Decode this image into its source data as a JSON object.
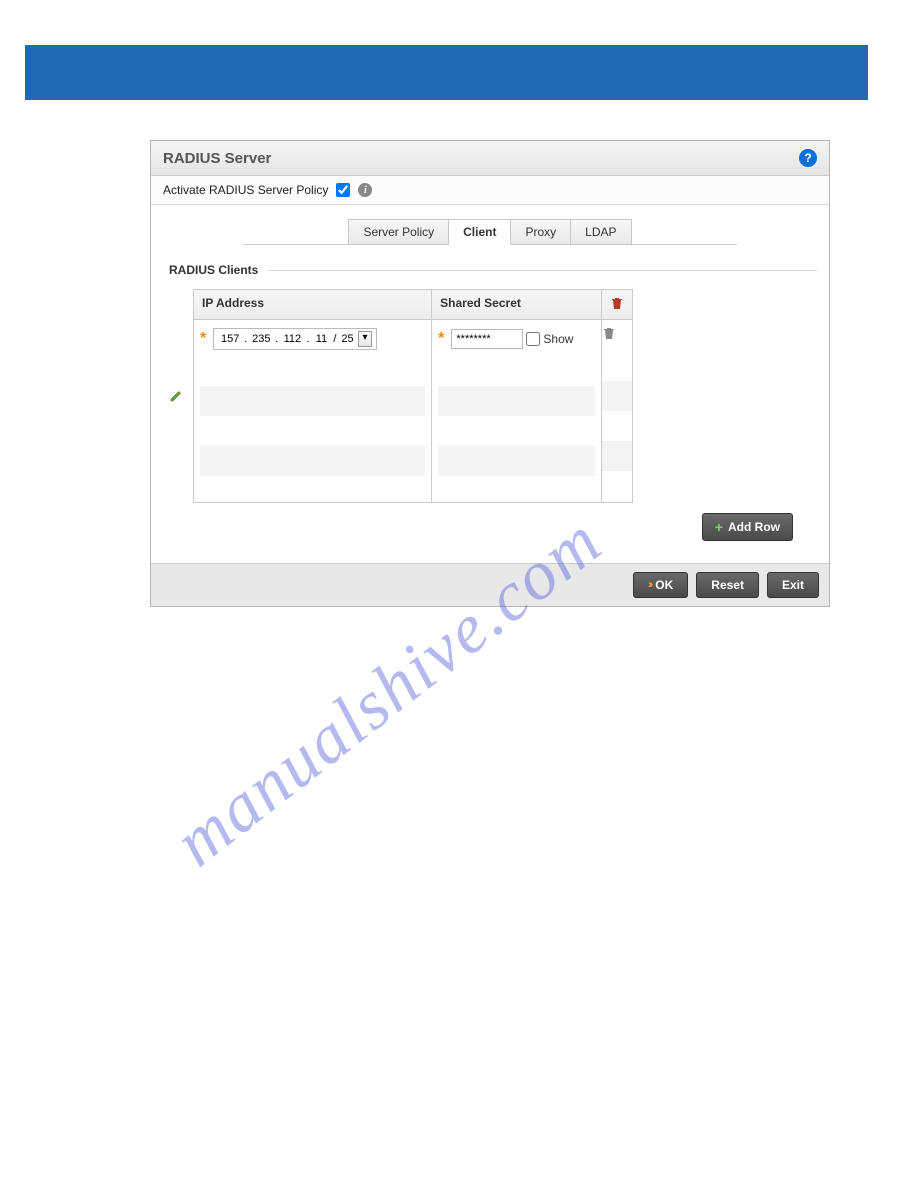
{
  "dialog": {
    "title": "RADIUS Server",
    "activate_label": "Activate RADIUS Server Policy",
    "activate_checked": true
  },
  "tabs": [
    {
      "label": "Server Policy",
      "active": false
    },
    {
      "label": "Client",
      "active": true
    },
    {
      "label": "Proxy",
      "active": false
    },
    {
      "label": "LDAP",
      "active": false
    }
  ],
  "section_title": "RADIUS Clients",
  "columns": {
    "ip": "IP Address",
    "secret": "Shared Secret"
  },
  "row": {
    "octet1": "157",
    "octet2": "235",
    "octet3": "112",
    "octet4": "11",
    "cidr": "25",
    "secret_masked": "********",
    "show_label": "Show"
  },
  "buttons": {
    "add_row": "Add Row",
    "ok": "OK",
    "reset": "Reset",
    "exit": "Exit"
  },
  "watermark": "manualshive.com"
}
